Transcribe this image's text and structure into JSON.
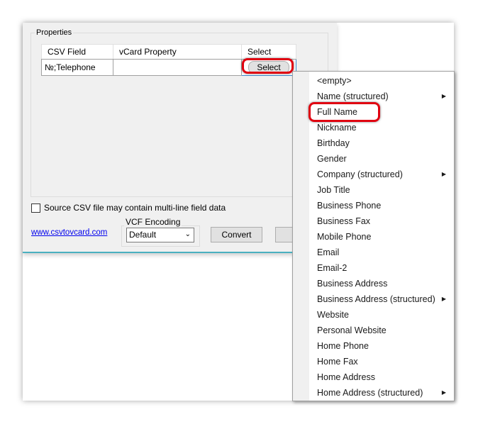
{
  "properties": {
    "title": "Properties",
    "headers": [
      "CSV Field",
      "vCard Property",
      "Select"
    ],
    "rows": [
      {
        "csv_field": "№;Telephone",
        "vcard_property": "",
        "button": "Select"
      }
    ]
  },
  "multiline_checkbox": {
    "label": "Source CSV file may contain multi-line field data",
    "checked": false
  },
  "link": "www.csvtovcard.com",
  "encoding": {
    "title": "VCF Encoding",
    "value": "Default"
  },
  "convert_label": "Convert",
  "menu": {
    "items": [
      {
        "label": "<empty>",
        "submenu": false
      },
      {
        "label": "Name (structured)",
        "submenu": true
      },
      {
        "label": "Full Name",
        "submenu": false,
        "highlighted": true
      },
      {
        "label": "Nickname",
        "submenu": false
      },
      {
        "label": "Birthday",
        "submenu": false
      },
      {
        "label": "Gender",
        "submenu": false
      },
      {
        "label": "Company (structured)",
        "submenu": true
      },
      {
        "label": "Job Title",
        "submenu": false
      },
      {
        "label": "Business Phone",
        "submenu": false
      },
      {
        "label": "Business Fax",
        "submenu": false
      },
      {
        "label": "Mobile Phone",
        "submenu": false
      },
      {
        "label": "Email",
        "submenu": false
      },
      {
        "label": "Email-2",
        "submenu": false
      },
      {
        "label": "Business Address",
        "submenu": false
      },
      {
        "label": "Business Address (structured)",
        "submenu": true
      },
      {
        "label": "Website",
        "submenu": false
      },
      {
        "label": "Personal Website",
        "submenu": false
      },
      {
        "label": "Home Phone",
        "submenu": false
      },
      {
        "label": "Home Fax",
        "submenu": false
      },
      {
        "label": "Home Address",
        "submenu": false
      },
      {
        "label": "Home Address (structured)",
        "submenu": true
      }
    ]
  },
  "colors": {
    "highlight": "#e00010",
    "link": "#0000ee",
    "accent": "#4ab0c0"
  }
}
